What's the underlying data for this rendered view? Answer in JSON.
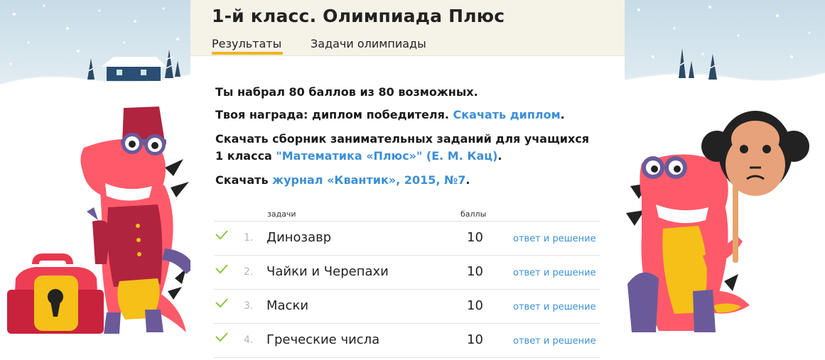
{
  "header": {
    "title": "1-й класс. Олимпиада Плюс",
    "tabs": [
      {
        "label": "Результаты",
        "active": true
      },
      {
        "label": "Задачи олимпиады",
        "active": false
      }
    ]
  },
  "results": {
    "score_line": "Ты набрал 80 баллов из 80 возможных.",
    "award_prefix": "Твоя награда: диплом победителя. ",
    "award_link": "Скачать диплом",
    "collection_prefix_line1": "Скачать сборник занимательных заданий для учащихся",
    "collection_prefix_line2": "1 класса ",
    "collection_link": "\"Математика «Плюс»\" (Е. М. Кац)",
    "journal_prefix": "Скачать ",
    "journal_link": "журнал «Квантик», 2015, №7",
    "period": "."
  },
  "table": {
    "headers": {
      "tasks": "задачи",
      "points": "баллы"
    },
    "rows": [
      {
        "num": "1.",
        "task": "Динозавр",
        "score": "10",
        "link": "ответ и решение"
      },
      {
        "num": "2.",
        "task": "Чайки и Черепахи",
        "score": "10",
        "link": "ответ и решение"
      },
      {
        "num": "3.",
        "task": "Маски",
        "score": "10",
        "link": "ответ и решение"
      },
      {
        "num": "4.",
        "task": "Греческие числа",
        "score": "10",
        "link": "ответ и решение"
      }
    ]
  },
  "colors": {
    "accent_tab": "#f0b323",
    "link": "#3b8fd6",
    "check": "#8cc63f",
    "header_bg": "#f5f3e8",
    "sky": "#cfe3ec",
    "dragon": "#ff5a6a"
  }
}
